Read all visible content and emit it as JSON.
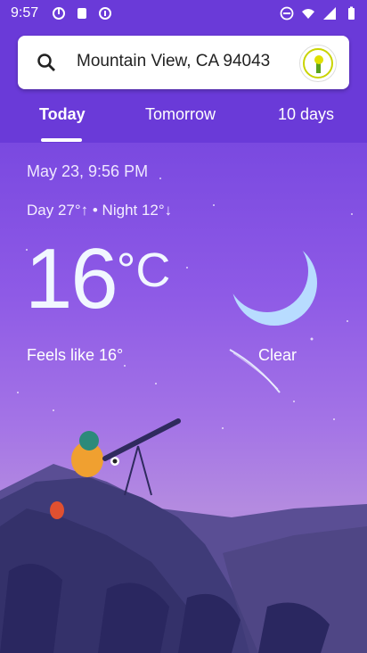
{
  "status_bar": {
    "time": "9:57",
    "icons": [
      "media-icon",
      "cloud-download-icon",
      "vpn-icon",
      "do-not-disturb-icon",
      "wifi-icon",
      "signal-icon",
      "battery-icon"
    ]
  },
  "search": {
    "location": "Mountain View, CA 94043",
    "icon": "search-icon"
  },
  "tabs": [
    {
      "label": "Today",
      "active": true
    },
    {
      "label": "Tomorrow",
      "active": false
    },
    {
      "label": "10 days",
      "active": false
    }
  ],
  "weather": {
    "date_time": "May 23, 9:56 PM",
    "day_night": "Day 27°↑ • Night 12°↓",
    "temperature": "16",
    "unit": "°C",
    "feels_like": "Feels like 16°",
    "condition": "Clear"
  },
  "colors": {
    "accent": "#6a3ad8",
    "moon": "#b8dcff",
    "text": "#ffffff"
  }
}
